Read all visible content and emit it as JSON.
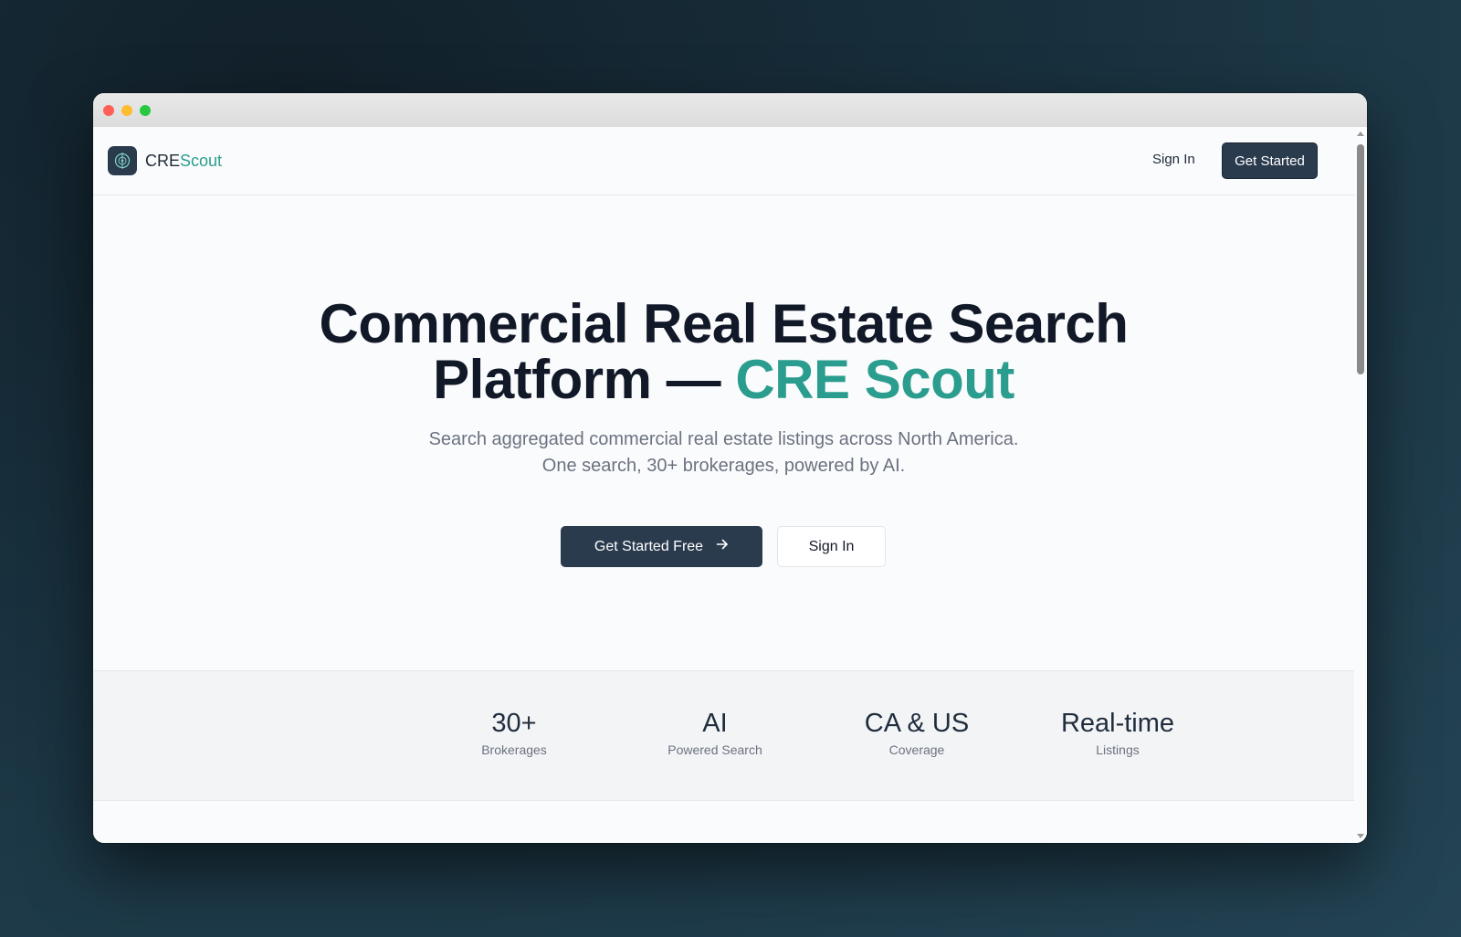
{
  "brand": {
    "name_part1": "CRE",
    "name_part2": "Scout",
    "logo_icon": "target-compass-icon",
    "accent_color": "#2a9d8f",
    "primary_color": "#2b3b4e"
  },
  "nav": {
    "sign_in_label": "Sign In",
    "get_started_label": "Get Started"
  },
  "hero": {
    "title_line1": "Commercial Real Estate Search",
    "title_line2_prefix": "Platform — ",
    "title_line2_accent": "CRE Scout",
    "subtitle_line1": "Search aggregated commercial real estate listings across North America.",
    "subtitle_line2": "One search, 30+ brokerages, powered by AI.",
    "primary_cta_label": "Get Started Free",
    "primary_cta_icon": "arrow-right-icon",
    "secondary_cta_label": "Sign In"
  },
  "stats": [
    {
      "value": "30+",
      "label": "Brokerages"
    },
    {
      "value": "AI",
      "label": "Powered Search"
    },
    {
      "value": "CA & US",
      "label": "Coverage"
    },
    {
      "value": "Real-time",
      "label": "Listings"
    }
  ]
}
